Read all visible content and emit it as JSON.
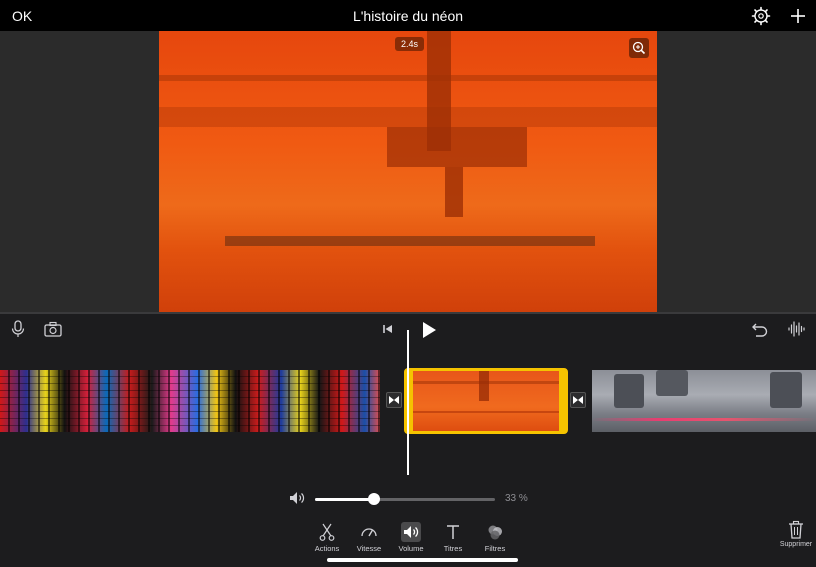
{
  "header": {
    "ok_label": "OK",
    "title": "L'histoire du néon",
    "settings_icon": "gear-icon",
    "add_icon": "plus-icon"
  },
  "viewer": {
    "duration_badge": "2.4s",
    "zoom_icon": "magnifier-plus-icon"
  },
  "timeline": {
    "mic_icon": "microphone-icon",
    "camera_icon": "camera-icon",
    "skip_start_icon": "skip-to-start-icon",
    "play_icon": "play-icon",
    "undo_icon": "undo-icon",
    "audio_icon": "waveform-icon",
    "transition_icon": "bowtie-transition-icon"
  },
  "volume": {
    "percent": 33,
    "label": "33 %"
  },
  "tools": [
    {
      "label": "Actions",
      "icon": "scissors-icon"
    },
    {
      "label": "Vitesse",
      "icon": "speedometer-icon"
    },
    {
      "label": "Volume",
      "icon": "speaker-icon"
    },
    {
      "label": "Titres",
      "icon": "text-t-icon"
    },
    {
      "label": "Filtres",
      "icon": "circles-icon"
    }
  ],
  "active_tool": "Volume",
  "delete_label": "Supprimer",
  "colors": {
    "selection": "#f5c300",
    "background": "#1c1c1e"
  }
}
